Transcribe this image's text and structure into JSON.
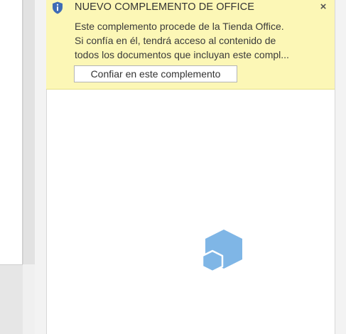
{
  "notification": {
    "title": "NUEVO COMPLEMENTO DE OFFICE",
    "close_glyph": "×",
    "lines": [
      "Este complemento procede de la Tienda Office.",
      "Si confía en él, tendrá acceso al contenido de",
      "todos los documentos que incluyan este compl..."
    ],
    "trust_button_label": "Confiar en este complemento",
    "icon": "info-shield-icon",
    "background_color": "#fcf7b6"
  },
  "loading": {
    "icon": "office-addin-hexagon-icon",
    "color": "#7fb6e6"
  }
}
